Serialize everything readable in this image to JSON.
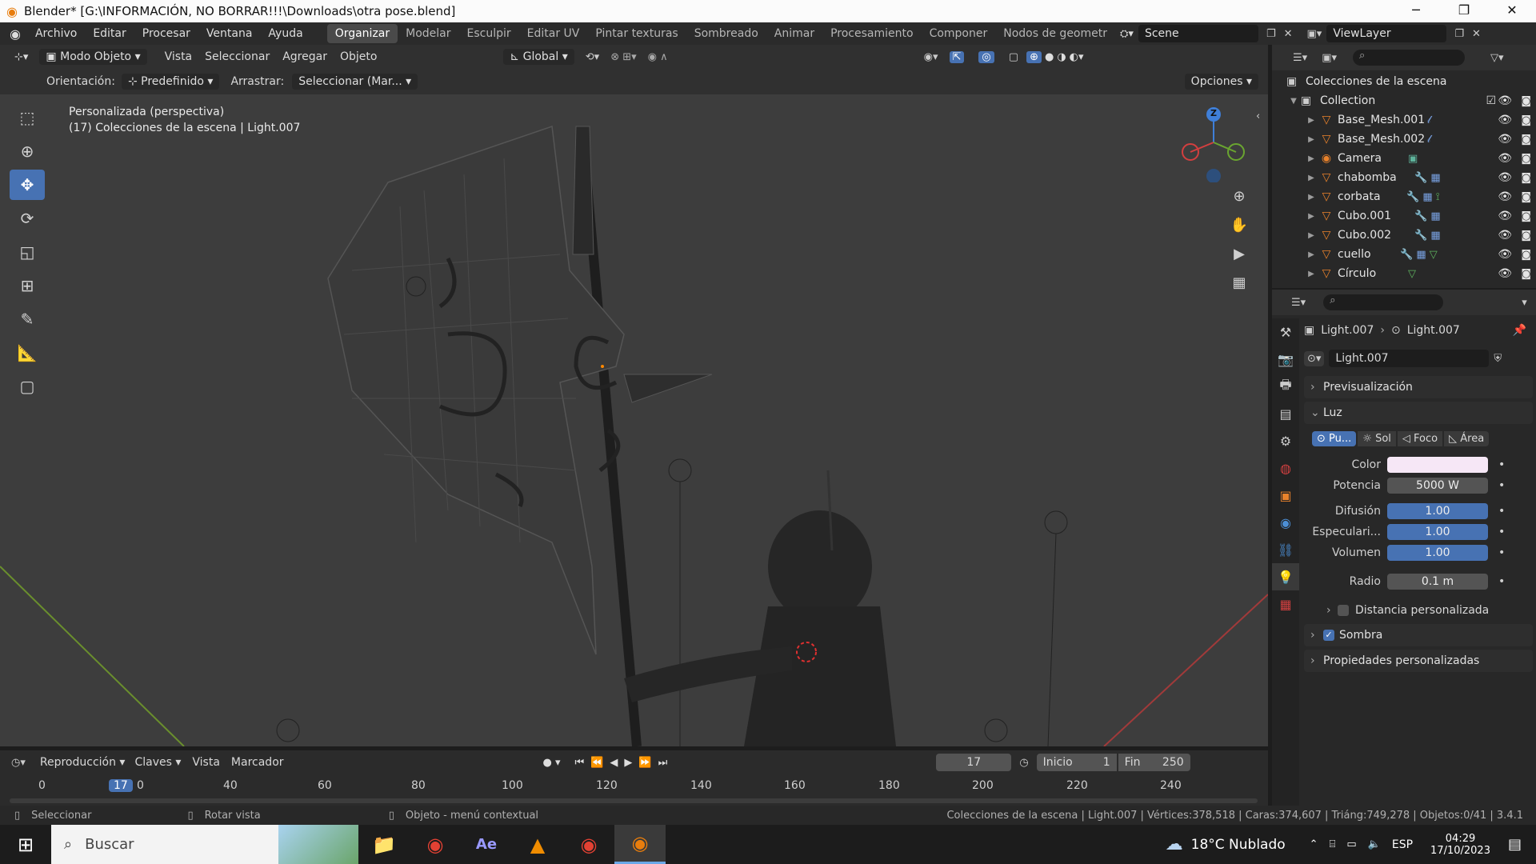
{
  "window": {
    "title": "Blender* [G:\\INFORMACIÓN, NO BORRAR!!!\\Downloads\\otra pose.blend]",
    "min": "─",
    "max": "❐",
    "close": "✕"
  },
  "menu": {
    "items": [
      "Archivo",
      "Editar",
      "Procesar",
      "Ventana",
      "Ayuda"
    ],
    "workspaces": [
      "Organizar",
      "Modelar",
      "Esculpir",
      "Editar UV",
      "Pintar texturas",
      "Sombreado",
      "Animar",
      "Procesamiento",
      "Componer",
      "Nodos de geometr"
    ],
    "active_workspace": "Organizar",
    "scene": "Scene",
    "view_layer": "ViewLayer"
  },
  "viewport_header": {
    "mode": "Modo Objeto",
    "items": [
      "Vista",
      "Seleccionar",
      "Agregar",
      "Objeto"
    ],
    "transform": "Global"
  },
  "tool_settings": {
    "orientation_label": "Orientación:",
    "orientation_value": "Predefinido",
    "drag_label": "Arrastrar:",
    "drag_value": "Seleccionar (Mar...",
    "options": "Opciones"
  },
  "viewport": {
    "view_name": "Personalizada (perspectiva)",
    "context": "(17) Colecciones de la escena | Light.007",
    "gizmo": {
      "z": "Z"
    }
  },
  "outliner": {
    "root": "Colecciones de la escena",
    "collection": "Collection",
    "items": [
      {
        "name": "Base_Mesh.001"
      },
      {
        "name": "Base_Mesh.002"
      },
      {
        "name": "Camera"
      },
      {
        "name": "chabomba"
      },
      {
        "name": "corbata"
      },
      {
        "name": "Cubo.001"
      },
      {
        "name": "Cubo.002"
      },
      {
        "name": "cuello"
      },
      {
        "name": "Círculo"
      }
    ]
  },
  "properties": {
    "breadcrumb_object": "Light.007",
    "breadcrumb_data": "Light.007",
    "datablock": "Light.007",
    "panels": {
      "preview": "Previsualización",
      "light": "Luz",
      "custom_distance": "Distancia personalizada",
      "shadow": "Sombra",
      "custom_props": "Propiedades personalizadas"
    },
    "light_types": [
      "Pu...",
      "Sol",
      "Foco",
      "Área"
    ],
    "fields": [
      {
        "label": "Color",
        "value": ""
      },
      {
        "label": "Potencia",
        "value": "5000 W"
      },
      {
        "label": "Difusión",
        "value": "1.00"
      },
      {
        "label": "Especulari...",
        "value": "1.00"
      },
      {
        "label": "Volumen",
        "value": "1.00"
      },
      {
        "label": "Radio",
        "value": "0.1 m"
      }
    ],
    "color_swatch": "#f6e7f6"
  },
  "timeline": {
    "playback": "Reproducción",
    "keys": "Claves",
    "view": "Vista",
    "marker": "Marcador",
    "current_frame": "17",
    "start_label": "Inicio",
    "start_value": "1",
    "end_label": "Fin",
    "end_value": "250",
    "ticks": [
      "0",
      "40",
      "60",
      "80",
      "100",
      "120",
      "140",
      "160",
      "180",
      "200",
      "220",
      "240"
    ],
    "ruler_current": "17",
    "ruler_after": "0"
  },
  "status": {
    "select": "Seleccionar",
    "rotate": "Rotar vista",
    "context_menu": "Objeto - menú contextual",
    "stats": "Colecciones de la escena | Light.007 | Vértices:378,518 | Caras:374,607 | Triáng:749,278 | Objetos:0/41 | 3.4.1"
  },
  "taskbar": {
    "search_placeholder": "Buscar",
    "weather": "18°C  Nublado",
    "lang": "ESP",
    "time": "04:29",
    "date": "17/10/2023"
  },
  "colors": {
    "accent_blue": "#4772b3",
    "object_orange": "#e9822b"
  }
}
